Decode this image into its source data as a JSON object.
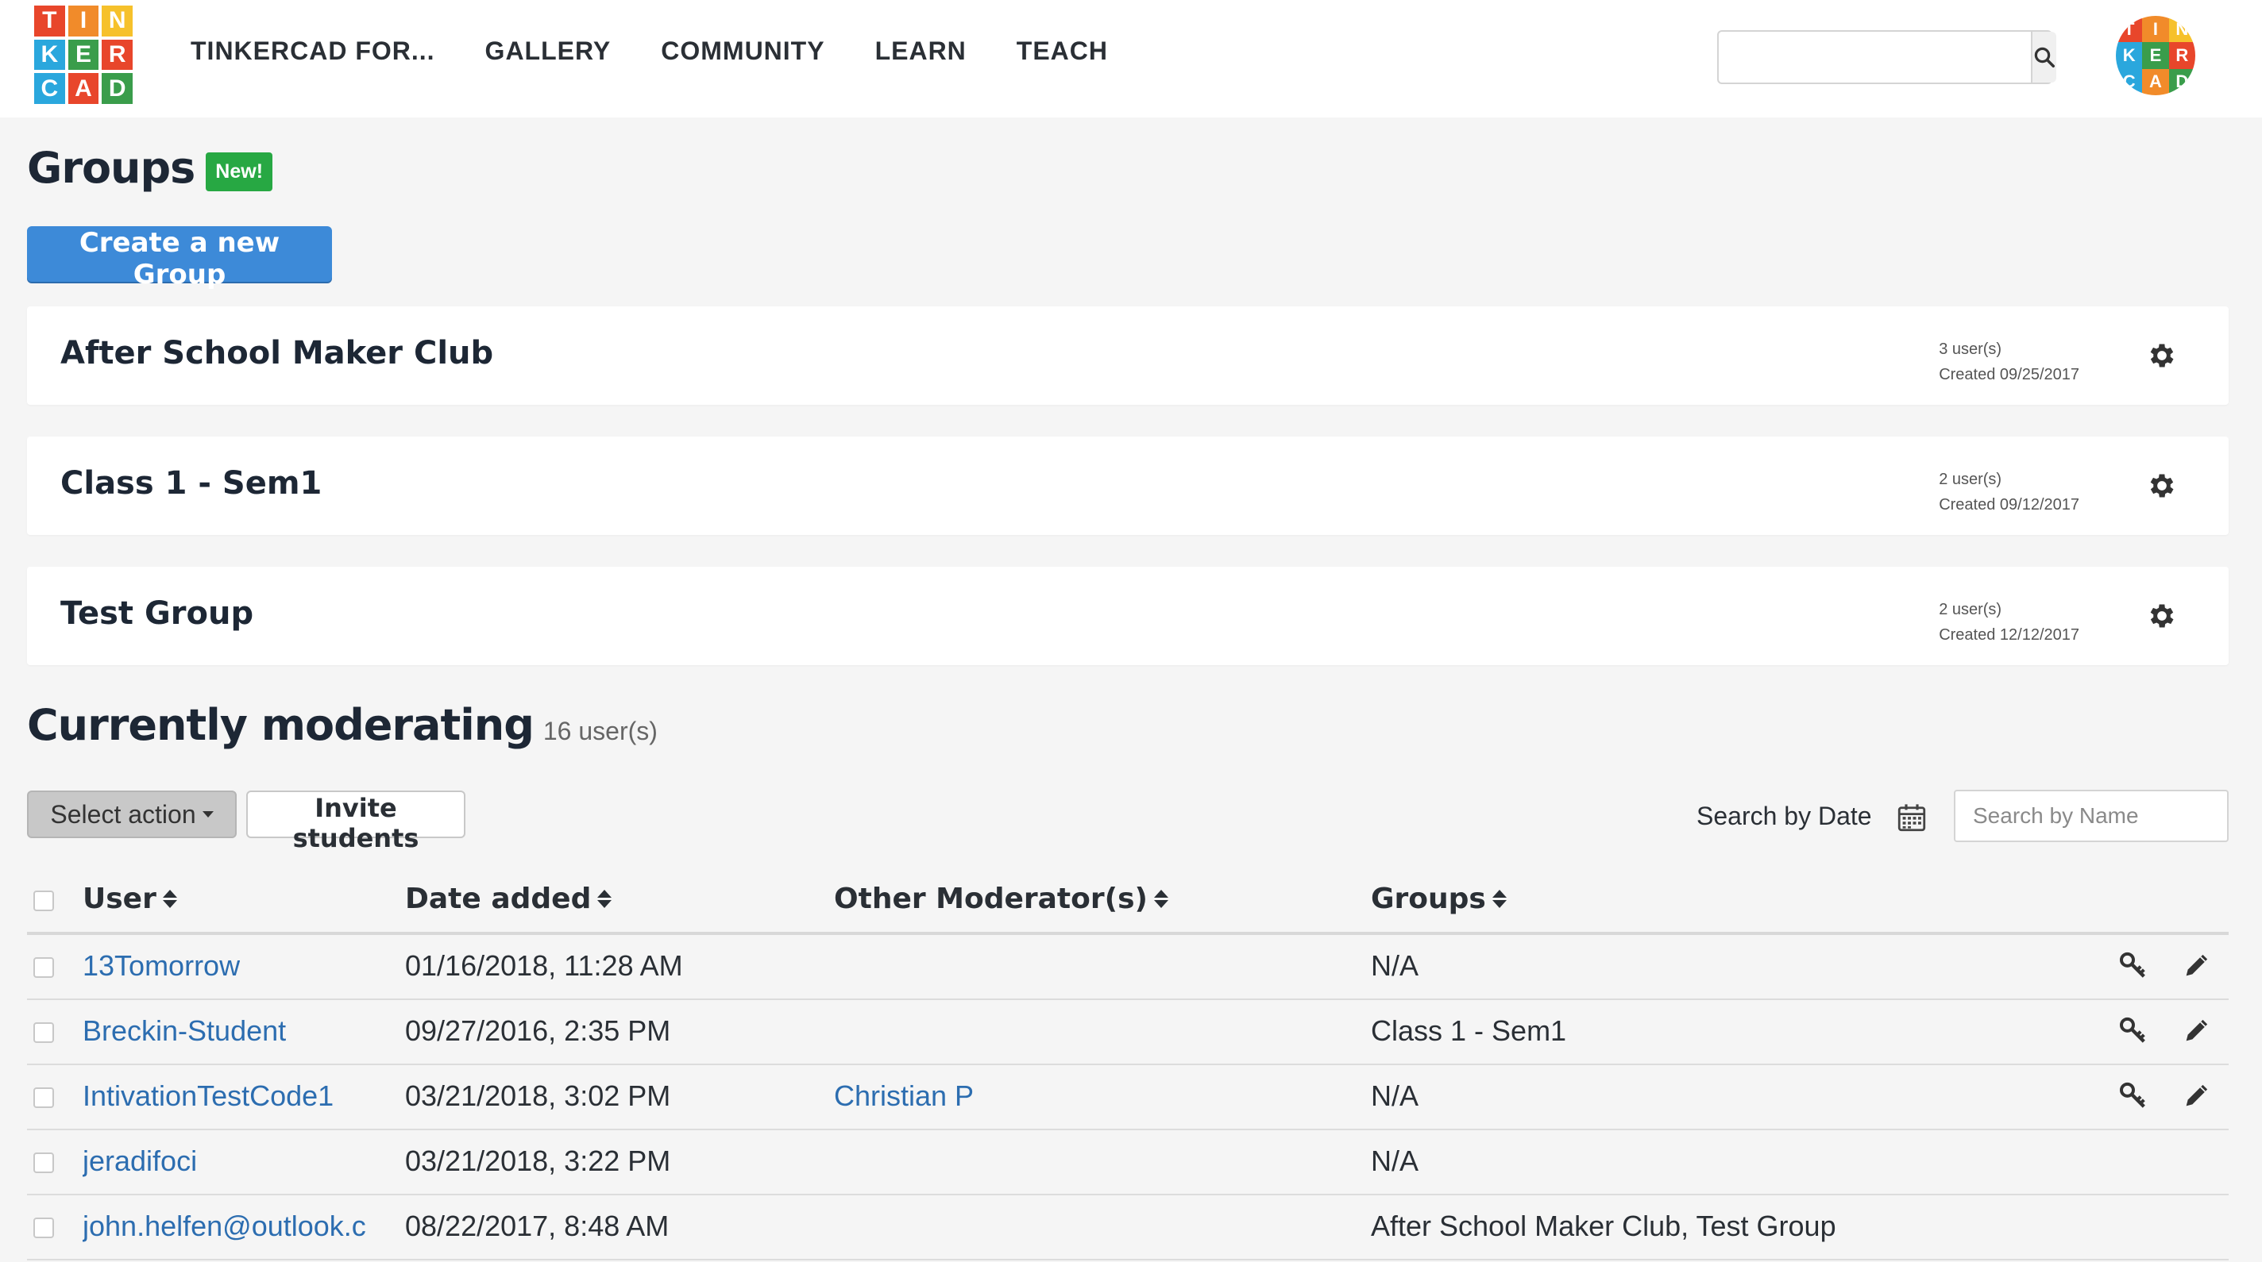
{
  "header": {
    "logo_letters": [
      "T",
      "I",
      "N",
      "K",
      "E",
      "R",
      "C",
      "A",
      "D"
    ],
    "logo_colors": [
      "#e8462b",
      "#f18b2a",
      "#f6c12b",
      "#2aa7dd",
      "#3a9d4b",
      "#e8462b",
      "#2aa7dd",
      "#e8462b",
      "#3a9d4b"
    ],
    "nav": [
      "TINKERCAD FOR...",
      "GALLERY",
      "COMMUNITY",
      "LEARN",
      "TEACH"
    ],
    "search_placeholder": "",
    "search_icon": "search-icon",
    "avatar_letters": [
      "T",
      "I",
      "N",
      "K",
      "E",
      "R",
      "C",
      "A",
      "D"
    ],
    "avatar_colors": [
      "#e8462b",
      "#f18b2a",
      "#f6c12b",
      "#2aa7dd",
      "#3a9d4b",
      "#e8462b",
      "#2aa7dd",
      "#f18b2a",
      "#3a9d4b"
    ]
  },
  "groups_section": {
    "title": "Groups",
    "badge": "New!",
    "create_button": "Create a new Group",
    "groups": [
      {
        "name": "After School Maker Club",
        "users": "3 user(s)",
        "created": "Created 09/25/2017"
      },
      {
        "name": "Class 1 - Sem1",
        "users": "2 user(s)",
        "created": "Created 09/12/2017"
      },
      {
        "name": "Test Group",
        "users": "2 user(s)",
        "created": "Created 12/12/2017"
      }
    ]
  },
  "moderating": {
    "title": "Currently moderating",
    "count": "16 user(s)",
    "select_action": "Select action",
    "invite_button": "Invite students",
    "search_by_date": "Search by Date",
    "search_by_name_placeholder": "Search by Name",
    "columns": [
      "User",
      "Date added",
      "Other Moderator(s)",
      "Groups"
    ],
    "rows": [
      {
        "user": "13Tomorrow",
        "date": "01/16/2018, 11:28 AM",
        "moderator": "",
        "groups": "N/A",
        "actions": true
      },
      {
        "user": "Breckin-Student",
        "date": "09/27/2016, 2:35 PM",
        "moderator": "",
        "groups": "Class 1 - Sem1",
        "actions": true
      },
      {
        "user": "IntivationTestCode1",
        "date": "03/21/2018, 3:02 PM",
        "moderator": "Christian P",
        "groups": "N/A",
        "actions": true
      },
      {
        "user": "jeradifoci",
        "date": "03/21/2018, 3:22 PM",
        "moderator": "",
        "groups": "N/A",
        "actions": false
      },
      {
        "user": "john.helfen@outlook.c",
        "date": "08/22/2017, 8:48 AM",
        "moderator": "",
        "groups": "After School Maker Club, Test Group",
        "actions": false
      }
    ]
  },
  "colors": {
    "primary": "#3d8ad8",
    "badge_green": "#27a843",
    "link": "#2c6db0"
  }
}
